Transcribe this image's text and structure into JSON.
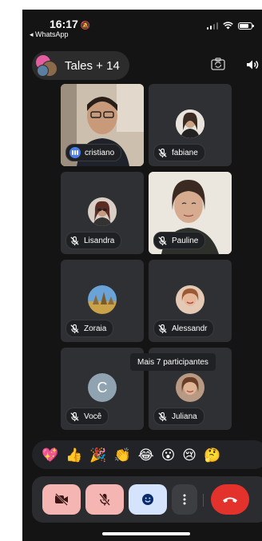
{
  "status_bar": {
    "time": "16:17",
    "back_app": "◂ WhatsApp"
  },
  "header": {
    "title": "Tales + 14"
  },
  "participants": [
    {
      "name": "cristiano",
      "mic": "speaking"
    },
    {
      "name": "fabiane",
      "mic": "muted"
    },
    {
      "name": "Lisandra",
      "mic": "muted"
    },
    {
      "name": "Pauline",
      "mic": "muted"
    },
    {
      "name": "Zoraia",
      "mic": "muted"
    },
    {
      "name": "Alessandr",
      "mic": "muted"
    },
    {
      "name": "Você",
      "mic": "muted",
      "avatar_letter": "C"
    },
    {
      "name": "Juliana",
      "mic": "muted"
    }
  ],
  "tooltip": "Mais 7 participantes",
  "reactions": [
    "💖",
    "👍",
    "🎉",
    "👏",
    "😂",
    "😮",
    "😢",
    "🤔"
  ],
  "controls": {
    "camera": "camera-off-icon",
    "mic": "mic-off-icon",
    "emoji": "emoji-icon",
    "more": "more-vertical-icon",
    "hangup": "hang-up-icon"
  },
  "colors": {
    "background": "#141414",
    "tile": "#2f3033",
    "speaking": "#4b7ee8",
    "muted_button": "#f4b5b3",
    "emoji_button": "#d6e3fc",
    "hangup": "#e3322c"
  }
}
